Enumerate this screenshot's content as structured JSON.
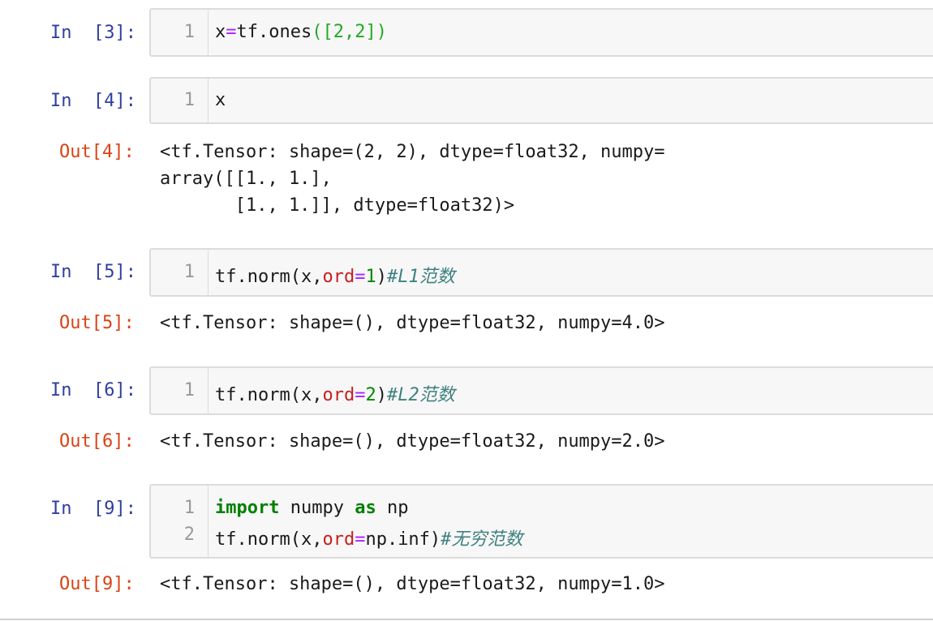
{
  "cells": [
    {
      "in_prompt": "In  [3]:",
      "lines": [
        {
          "no": "1",
          "segments": [
            {
              "t": "x",
              "k": "plain"
            },
            {
              "t": "=",
              "k": "op"
            },
            {
              "t": "tf.ones",
              "k": "plain"
            },
            {
              "t": "([2,2])",
              "k": "bracket"
            }
          ]
        }
      ]
    },
    {
      "in_prompt": "In  [4]:",
      "lines": [
        {
          "no": "1",
          "segments": [
            {
              "t": "x",
              "k": "plain"
            }
          ]
        }
      ],
      "out_prompt": "Out[4]:",
      "output": [
        "<tf.Tensor: shape=(2, 2), dtype=float32, numpy=",
        "array([[1., 1.],",
        "       [1., 1.]], dtype=float32)>"
      ]
    },
    {
      "in_prompt": "In  [5]:",
      "lines": [
        {
          "no": "1",
          "segments": [
            {
              "t": "tf.norm(x,",
              "k": "plain"
            },
            {
              "t": "ord",
              "k": "num"
            },
            {
              "t": "=",
              "k": "op"
            },
            {
              "t": "1",
              "k": "num"
            },
            {
              "t": ")",
              "k": "plain"
            },
            {
              "t": "#L1范数",
              "k": "comment"
            }
          ]
        }
      ],
      "out_prompt": "Out[5]:",
      "output": [
        "<tf.Tensor: shape=(), dtype=float32, numpy=4.0>"
      ]
    },
    {
      "in_prompt": "In  [6]:",
      "lines": [
        {
          "no": "1",
          "segments": [
            {
              "t": "tf.norm(x,",
              "k": "plain"
            },
            {
              "t": "ord",
              "k": "num"
            },
            {
              "t": "=",
              "k": "op"
            },
            {
              "t": "2",
              "k": "num"
            },
            {
              "t": ")",
              "k": "plain"
            },
            {
              "t": "#L2范数",
              "k": "comment"
            }
          ]
        }
      ],
      "out_prompt": "Out[6]:",
      "output": [
        "<tf.Tensor: shape=(), dtype=float32, numpy=2.0>"
      ]
    },
    {
      "in_prompt": "In  [9]:",
      "lines": [
        {
          "no": "1",
          "segments": [
            {
              "t": "import",
              "k": "kw"
            },
            {
              "t": " numpy ",
              "k": "plain"
            },
            {
              "t": "as",
              "k": "kw"
            },
            {
              "t": " np",
              "k": "plain"
            }
          ]
        },
        {
          "no": "2",
          "segments": [
            {
              "t": "tf.norm(x,",
              "k": "plain"
            },
            {
              "t": "ord",
              "k": "num"
            },
            {
              "t": "=",
              "k": "op"
            },
            {
              "t": "np.inf)",
              "k": "plain"
            },
            {
              "t": "#无穷范数",
              "k": "comment"
            }
          ]
        }
      ],
      "out_prompt": "Out[9]:",
      "output": [
        "<tf.Tensor: shape=(), dtype=float32, numpy=1.0>"
      ]
    }
  ],
  "colors": {
    "in_prompt": "#303f9f",
    "out_prompt": "#d84315",
    "keyword": "#008000",
    "comment": "#408080",
    "operator": "#aa22ff",
    "number": "#008800"
  }
}
